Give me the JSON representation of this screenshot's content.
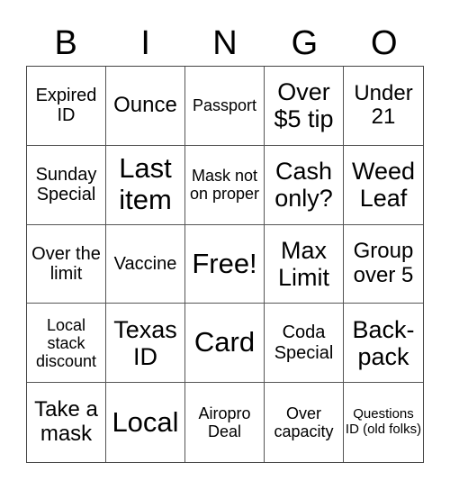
{
  "header": {
    "letters": [
      "B",
      "I",
      "N",
      "G",
      "O"
    ]
  },
  "board": {
    "rows": [
      [
        "Expired ID",
        "Ounce",
        "Passport",
        "Over $5 tip",
        "Under 21"
      ],
      [
        "Sunday Special",
        "Last item",
        "Mask not on proper",
        "Cash only?",
        "Weed Leaf"
      ],
      [
        "Over the limit",
        "Vaccine",
        "Free!",
        "Max Limit",
        "Group over 5"
      ],
      [
        "Local stack discount",
        "Texas ID",
        "Card",
        "Coda Special",
        "Back-pack"
      ],
      [
        "Take a mask",
        "Local",
        "Airopro Deal",
        "Over capacity",
        "Questions ID (old folks)"
      ]
    ]
  },
  "colors": {
    "background": "#ffffff",
    "text": "#000000",
    "grid_line": "#555555"
  }
}
